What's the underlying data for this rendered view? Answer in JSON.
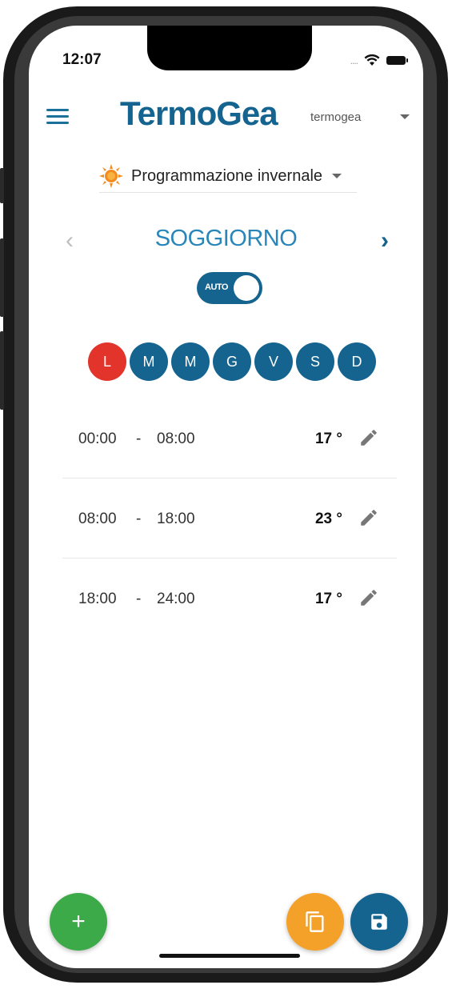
{
  "status_bar": {
    "time": "12:07",
    "signal": "....",
    "colors": {
      "accent": "#15648f",
      "danger": "#e2342b",
      "add": "#3daa4a",
      "copy": "#f4a12a"
    }
  },
  "header": {
    "logo": "TermoGea",
    "user": "termogea"
  },
  "program": {
    "label": "Programmazione invernale",
    "icon": "sun-icon"
  },
  "room": {
    "name": "SOGGIORNO",
    "prev_icon": "‹",
    "next_icon": "›"
  },
  "mode_toggle": {
    "label": "AUTO",
    "on": true
  },
  "days": [
    {
      "label": "L",
      "active": true
    },
    {
      "label": "M",
      "active": false
    },
    {
      "label": "M",
      "active": false
    },
    {
      "label": "G",
      "active": false
    },
    {
      "label": "V",
      "active": false
    },
    {
      "label": "S",
      "active": false
    },
    {
      "label": "D",
      "active": false
    }
  ],
  "schedule": [
    {
      "start": "00:00",
      "sep": "-",
      "end": "08:00",
      "temp": "17 °"
    },
    {
      "start": "08:00",
      "sep": "-",
      "end": "18:00",
      "temp": "23 °"
    },
    {
      "start": "18:00",
      "sep": "-",
      "end": "24:00",
      "temp": "17 °"
    }
  ],
  "fabs": {
    "add_label": "+",
    "copy_icon": "copy-icon",
    "save_icon": "save-icon"
  }
}
